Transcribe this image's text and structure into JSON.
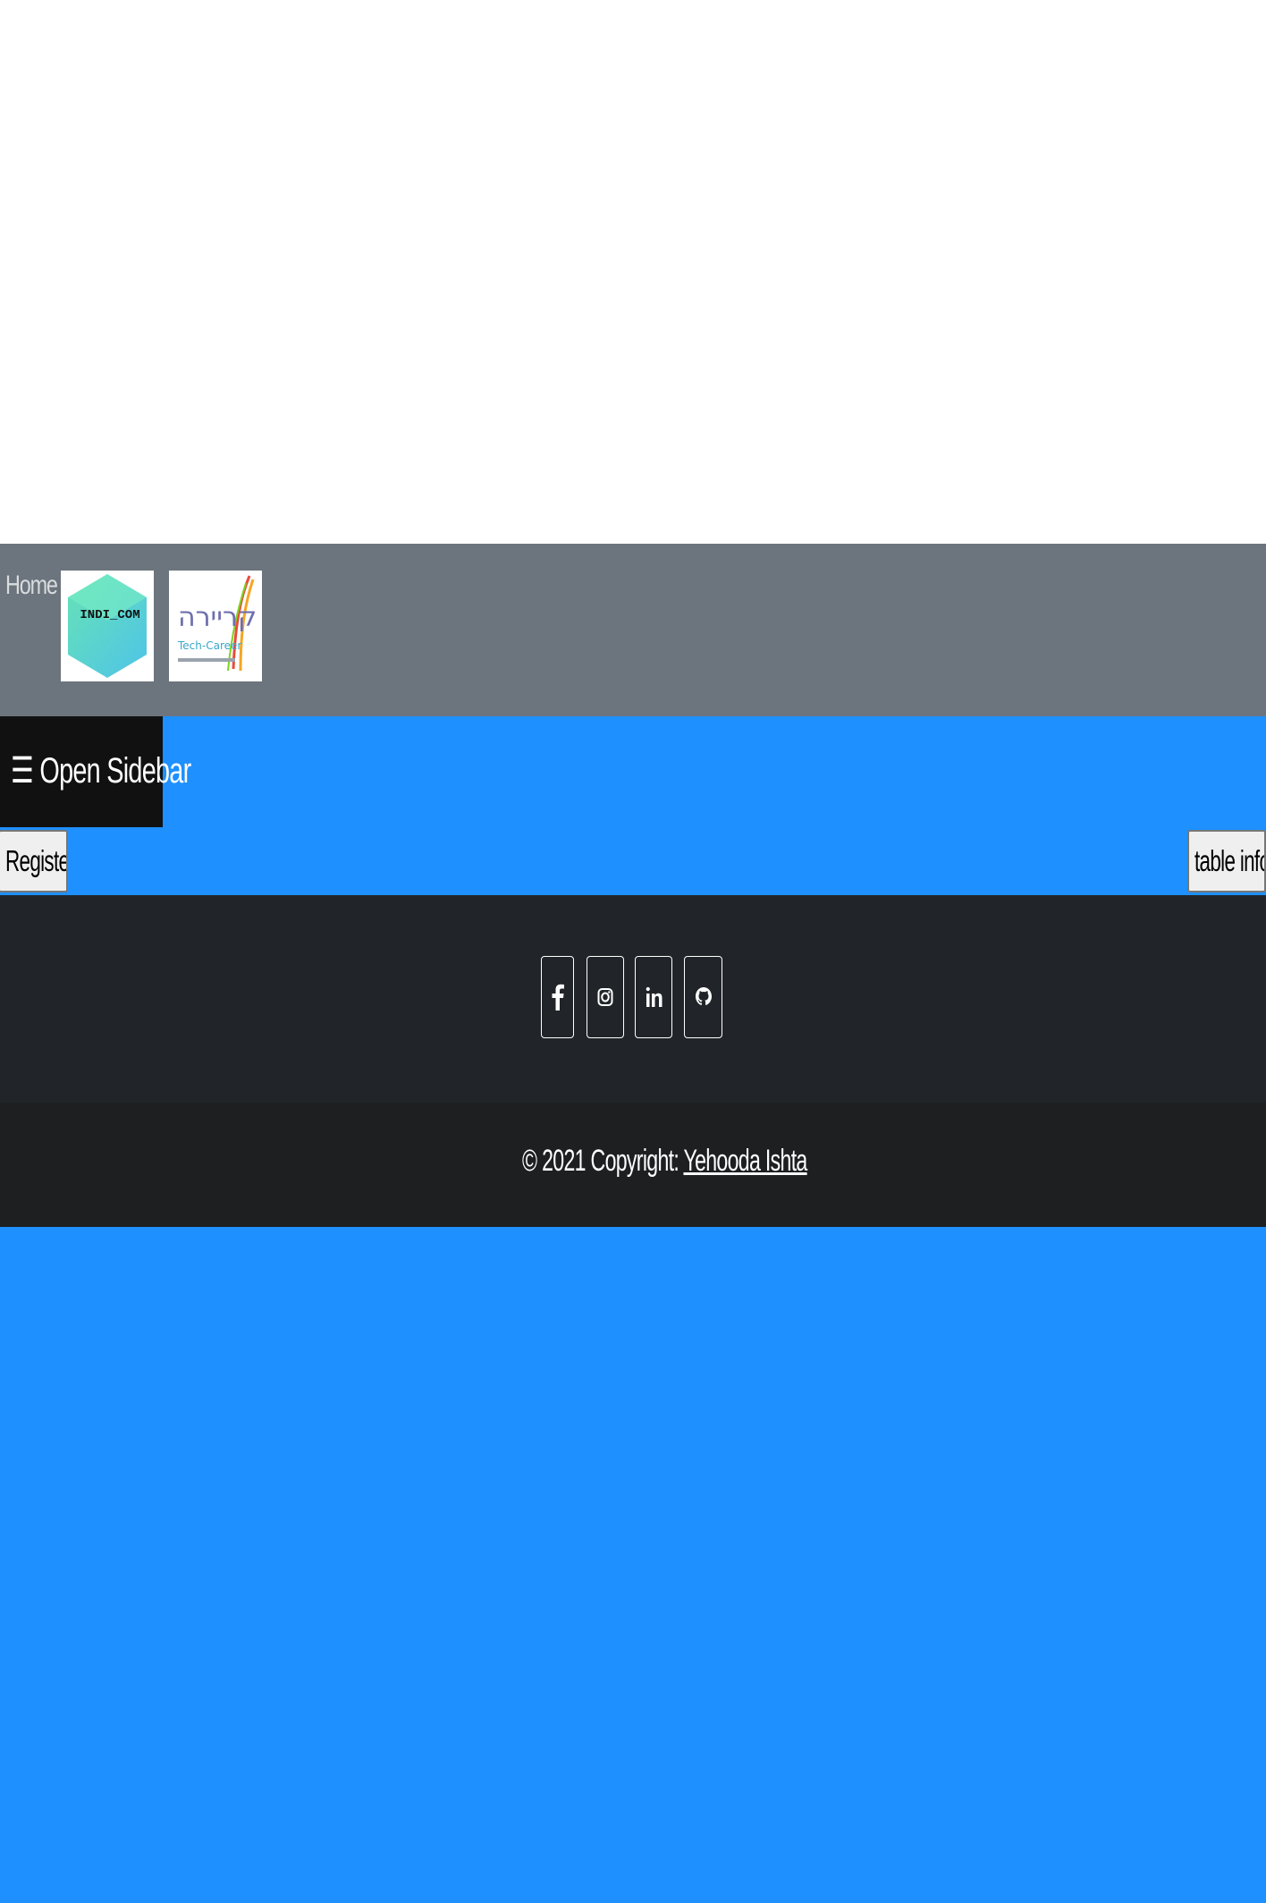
{
  "navbar": {
    "home_label": "Home",
    "logos": [
      {
        "name": "indicom-logo",
        "text": "INDI_COM"
      },
      {
        "name": "tech-career-logo",
        "text": "קריירה Tech-Career"
      }
    ]
  },
  "sidebar_button": {
    "icon": "☰",
    "label": "Open Sidebar"
  },
  "actions": {
    "register_label": "Register",
    "table_info_label": "table info:"
  },
  "social": {
    "icons": [
      "facebook-icon",
      "instagram-icon",
      "linkedin-icon",
      "github-icon"
    ]
  },
  "footer": {
    "copyright_prefix": "© 2021 Copyright: ",
    "author_link": "Yehooda Ishta"
  },
  "colors": {
    "page_background": "#1e90ff",
    "navbar": "#6c757d",
    "sidebar_button": "#111111",
    "social_section": "#212529",
    "copyright_bar": "#1d1f21"
  }
}
